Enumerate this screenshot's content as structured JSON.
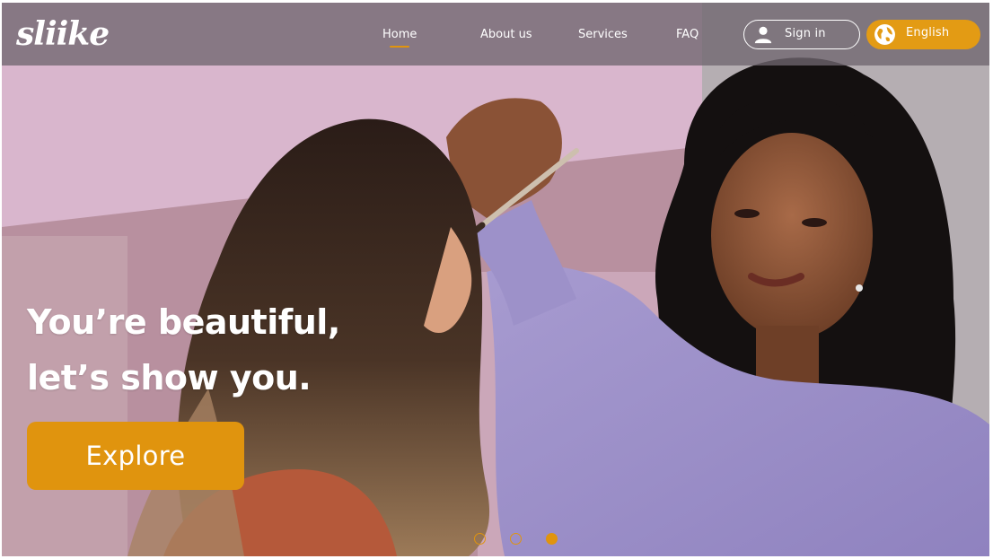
{
  "brand": {
    "logo_text": "sliike"
  },
  "nav": {
    "links": [
      {
        "label": "Home",
        "active": true
      },
      {
        "label": "About us",
        "active": false
      },
      {
        "label": "Services",
        "active": false
      },
      {
        "label": "FAQ",
        "active": false
      }
    ],
    "signin_label": "Sign in",
    "language_label": "English"
  },
  "hero": {
    "headline_line1": "You’re beautiful,",
    "headline_line2": "let’s show you.",
    "cta_label": "Explore",
    "image_icon": "makeup-artist-photo"
  },
  "carousel": {
    "slide_count": 3,
    "active_index": 2
  },
  "colors": {
    "accent": "#e0940e",
    "nav_overlay": "#706670",
    "text": "#ffffff"
  }
}
